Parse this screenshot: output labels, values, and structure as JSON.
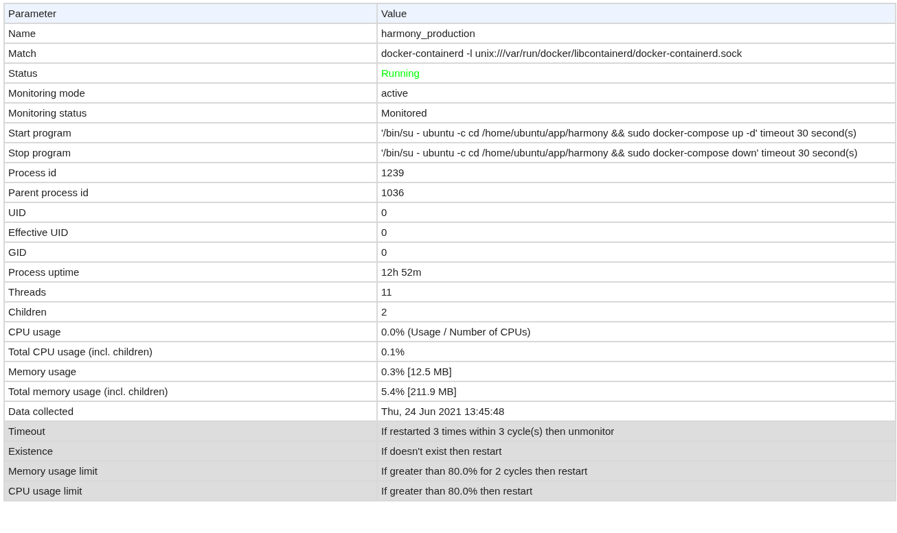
{
  "table": {
    "columns": [
      "Parameter",
      "Value"
    ],
    "rows": [
      {
        "kind": "info",
        "parameter": "Name",
        "value": "harmony_production"
      },
      {
        "kind": "info",
        "parameter": "Match",
        "value": "docker-containerd -l unix:///var/run/docker/libcontainerd/docker-containerd.sock"
      },
      {
        "kind": "info",
        "parameter": "Status",
        "value": "Running",
        "color": "#00ff00"
      },
      {
        "kind": "info",
        "parameter": "Monitoring mode",
        "value": "active"
      },
      {
        "kind": "info",
        "parameter": "Monitoring status",
        "value": "Monitored"
      },
      {
        "kind": "info",
        "parameter": "Start program",
        "value": "'/bin/su - ubuntu -c cd /home/ubuntu/app/harmony && sudo docker-compose up -d' timeout 30 second(s)"
      },
      {
        "kind": "info",
        "parameter": "Stop program",
        "value": "'/bin/su - ubuntu -c cd /home/ubuntu/app/harmony && sudo docker-compose down' timeout 30 second(s)"
      },
      {
        "kind": "info",
        "parameter": "Process id",
        "value": "1239"
      },
      {
        "kind": "info",
        "parameter": "Parent process id",
        "value": "1036"
      },
      {
        "kind": "info",
        "parameter": "UID",
        "value": "0"
      },
      {
        "kind": "info",
        "parameter": "Effective UID",
        "value": "0"
      },
      {
        "kind": "info",
        "parameter": "GID",
        "value": "0"
      },
      {
        "kind": "info",
        "parameter": "Process uptime",
        "value": "12h 52m"
      },
      {
        "kind": "info",
        "parameter": "Threads",
        "value": "11"
      },
      {
        "kind": "info",
        "parameter": "Children",
        "value": "2"
      },
      {
        "kind": "info",
        "parameter": "CPU usage",
        "value": "0.0% (Usage / Number of CPUs)"
      },
      {
        "kind": "info",
        "parameter": "Total CPU usage (incl. children)",
        "value": "0.1%"
      },
      {
        "kind": "info",
        "parameter": "Memory usage",
        "value": "0.3% [12.5 MB]"
      },
      {
        "kind": "info",
        "parameter": "Total memory usage (incl. children)",
        "value": "5.4% [211.9 MB]"
      },
      {
        "kind": "info",
        "parameter": "Data collected",
        "value": "Thu, 24 Jun 2021 13:45:48"
      },
      {
        "kind": "rule",
        "parameter": "Timeout",
        "value": "If restarted 3 times within 3 cycle(s) then unmonitor"
      },
      {
        "kind": "rule",
        "parameter": "Existence",
        "value": "If doesn't exist then restart"
      },
      {
        "kind": "rule",
        "parameter": "Memory usage limit",
        "value": "If greater than 80.0% for 2 cycles then restart"
      },
      {
        "kind": "rule",
        "parameter": "CPU usage limit",
        "value": "If greater than 80.0% then restart"
      }
    ]
  }
}
